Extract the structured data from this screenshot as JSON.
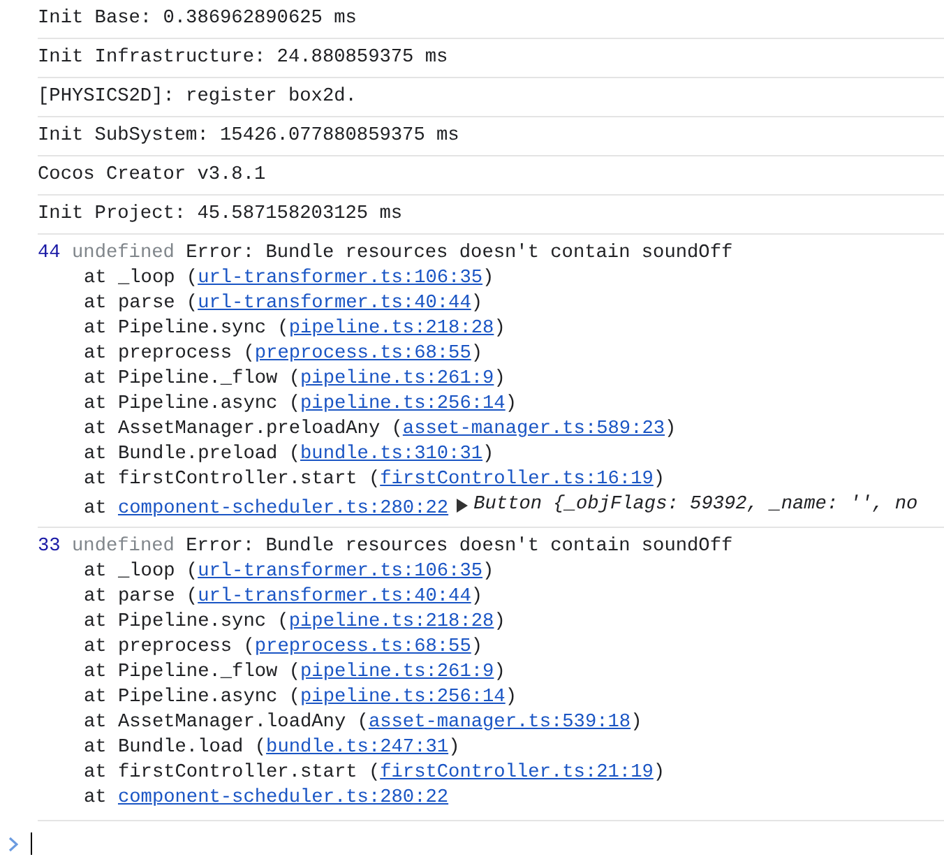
{
  "logs": [
    {
      "kind": "info",
      "text": "Init Base: 0.386962890625 ms"
    },
    {
      "kind": "info",
      "text": "Init Infrastructure: 24.880859375 ms"
    },
    {
      "kind": "info",
      "text": "[PHYSICS2D]: register box2d."
    },
    {
      "kind": "info",
      "text": "Init SubSystem: 15426.077880859375 ms"
    },
    {
      "kind": "info",
      "text": "Cocos Creator v3.8.1"
    },
    {
      "kind": "info",
      "text": "Init Project: 45.587158203125 ms"
    },
    {
      "kind": "error",
      "count": "44",
      "source": "undefined",
      "message": "Error: Bundle resources doesn't contain soundOff",
      "frames": [
        {
          "text": "at _loop (",
          "link": "url-transformer.ts:106:35",
          "end": ")"
        },
        {
          "text": "at parse (",
          "link": "url-transformer.ts:40:44",
          "end": ")"
        },
        {
          "text": "at Pipeline.sync (",
          "link": "pipeline.ts:218:28",
          "end": ")"
        },
        {
          "text": "at preprocess (",
          "link": "preprocess.ts:68:55",
          "end": ")"
        },
        {
          "text": "at Pipeline._flow (",
          "link": "pipeline.ts:261:9",
          "end": ")"
        },
        {
          "text": "at Pipeline.async (",
          "link": "pipeline.ts:256:14",
          "end": ")"
        },
        {
          "text": "at AssetManager.preloadAny (",
          "link": "asset-manager.ts:589:23",
          "end": ")"
        },
        {
          "text": "at Bundle.preload (",
          "link": "bundle.ts:310:31",
          "end": ")"
        },
        {
          "text": "at firstController.start (",
          "link": "firstController.ts:16:19",
          "end": ")"
        },
        {
          "text": "at ",
          "link": "component-scheduler.ts:280:22",
          "object": "Button {_objFlags: 59392, _name: '', no"
        }
      ]
    },
    {
      "kind": "error",
      "count": "33",
      "source": "undefined",
      "message": "Error: Bundle resources doesn't contain soundOff",
      "frames": [
        {
          "text": "at _loop (",
          "link": "url-transformer.ts:106:35",
          "end": ")"
        },
        {
          "text": "at parse (",
          "link": "url-transformer.ts:40:44",
          "end": ")"
        },
        {
          "text": "at Pipeline.sync (",
          "link": "pipeline.ts:218:28",
          "end": ")"
        },
        {
          "text": "at preprocess (",
          "link": "preprocess.ts:68:55",
          "end": ")"
        },
        {
          "text": "at Pipeline._flow (",
          "link": "pipeline.ts:261:9",
          "end": ")"
        },
        {
          "text": "at Pipeline.async (",
          "link": "pipeline.ts:256:14",
          "end": ")"
        },
        {
          "text": "at AssetManager.loadAny (",
          "link": "asset-manager.ts:539:18",
          "end": ")"
        },
        {
          "text": "at Bundle.load (",
          "link": "bundle.ts:247:31",
          "end": ")"
        },
        {
          "text": "at firstController.start (",
          "link": "firstController.ts:21:19",
          "end": ")"
        },
        {
          "text": "at ",
          "link": "component-scheduler.ts:280:22"
        }
      ]
    }
  ]
}
